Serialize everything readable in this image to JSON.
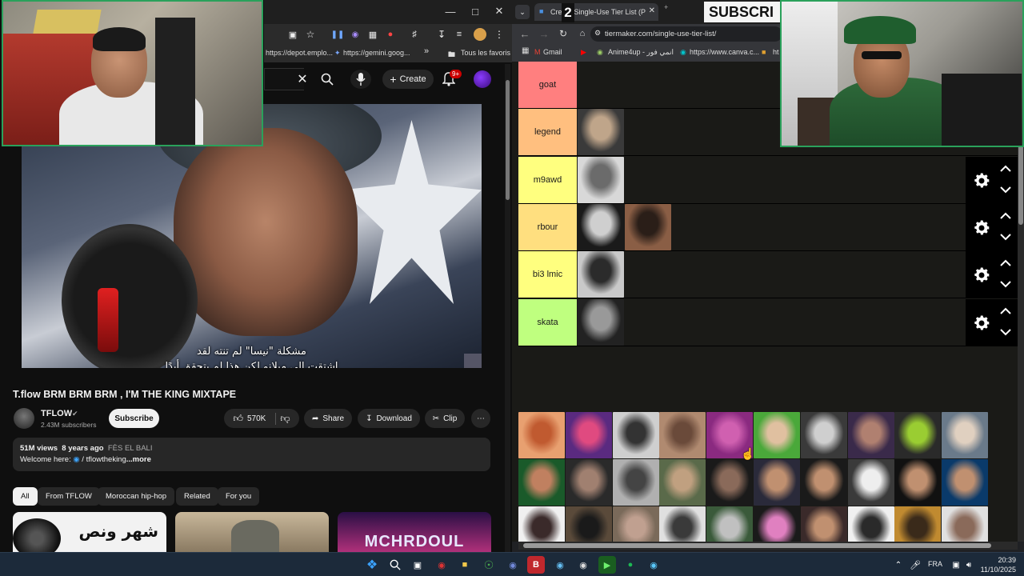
{
  "left_browser": {
    "bookmarks": [
      "https://depot.emplo...",
      "https://gemini.goog...",
      "Tous les favoris"
    ],
    "bookmark_more": "»"
  },
  "youtube": {
    "create_label": "Create",
    "notif_count": "9+",
    "subtitle_line1": "مشكلة \"نيسا\" لم تنته لقد",
    "subtitle_line2": "اشتقت إلى ميلانو لكن هذا لم يتحقق أبدًا",
    "video_title": "T.flow BRM BRM BRM , I'M THE KING MIXTAPE",
    "channel_name": "TFLOW",
    "subscribers": "2.43M subscribers",
    "subscribe_label": "Subscribe",
    "likes": "570K",
    "share_label": "Share",
    "download_label": "Download",
    "clip_label": "Clip",
    "views": "51M views",
    "age": "8 years ago",
    "location": "FÈS EL BALI",
    "welcome_prefix": "Welcome here:",
    "welcome_link": "/ tflowtheking",
    "more_label": "...more",
    "chips": [
      "All",
      "From TFLOW",
      "Moroccan hip-hop",
      "Related",
      "For you"
    ],
    "rec_titles": [
      "شهر ونص",
      "",
      "MCHRDOUL"
    ]
  },
  "right_browser": {
    "tab_label": "Create Single-Use Tier List (P",
    "tab_overlay": "2",
    "stream_overlay": "SUBSCRI",
    "url": "tiermaker.com/single-use-tier-list/",
    "bookmarks": [
      "Gmail",
      "Anime4up - انمي فور",
      "https://www.canva.c...",
      "ht"
    ]
  },
  "tiers": [
    {
      "label": "goat",
      "color": "#ff7f7f",
      "count": 0
    },
    {
      "label": "legend",
      "color": "#ffbf7f",
      "count": 1
    },
    {
      "label": "m9awd",
      "color": "#ffff7f",
      "count": 1
    },
    {
      "label": "rbour",
      "color": "#ffdf7f",
      "count": 2
    },
    {
      "label": "bi3 lmic",
      "color": "#ffff7f",
      "count": 1
    },
    {
      "label": "skata",
      "color": "#bfff7f",
      "count": 1
    }
  ],
  "taskbar": {
    "lang": "FRA",
    "time": "20:39",
    "date": "11/10/2025"
  }
}
